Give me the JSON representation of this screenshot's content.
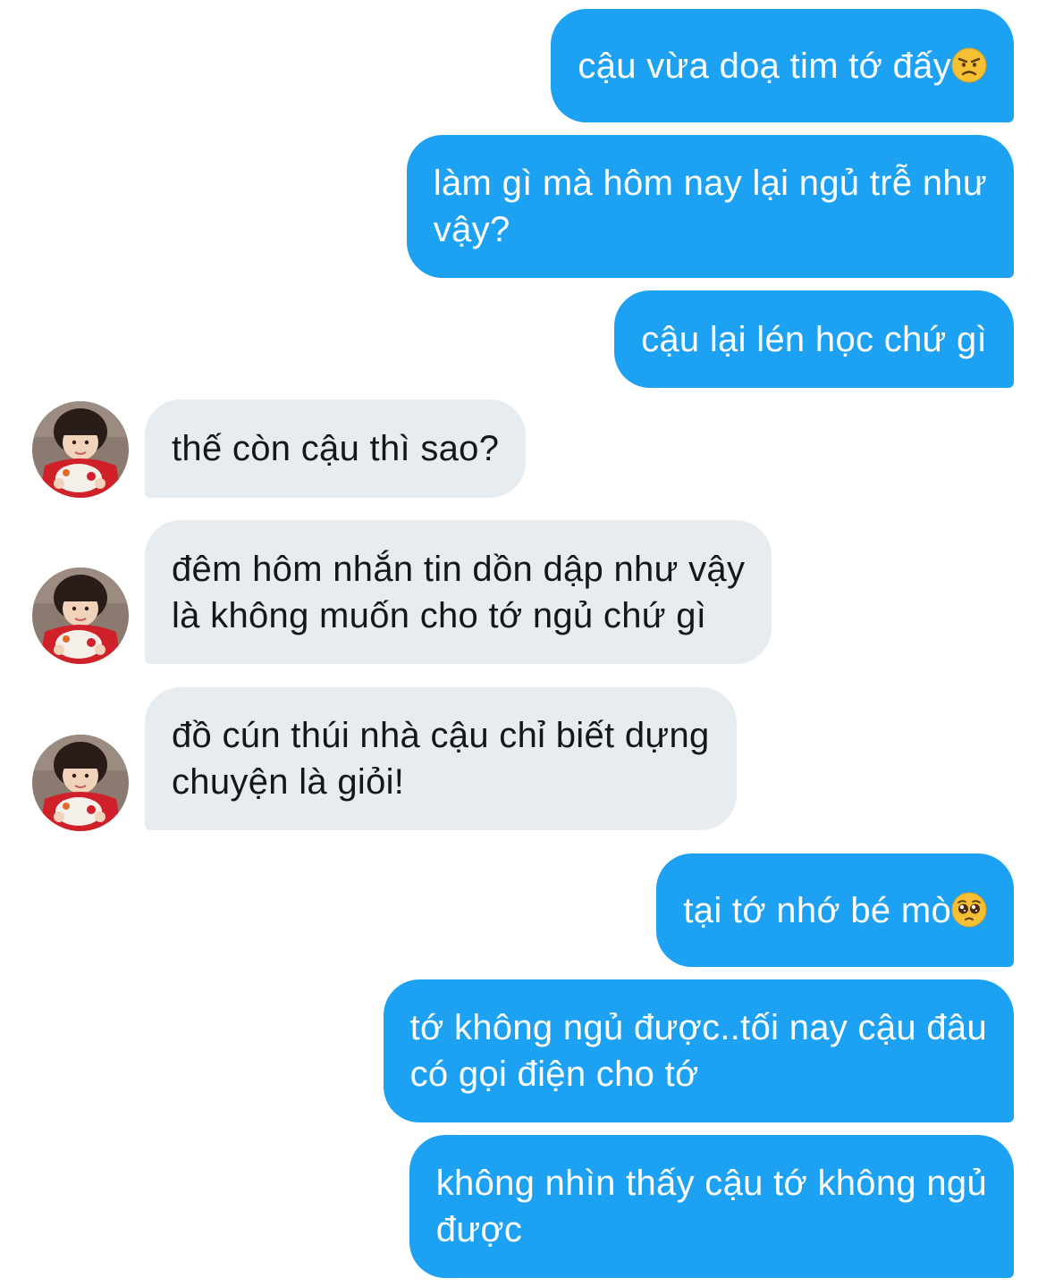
{
  "conversation": {
    "messages": [
      {
        "id": "m1",
        "from": "me",
        "text": "cậu vừa doạ tim tớ đấy",
        "emoji": "angry-face-emoji"
      },
      {
        "id": "m2",
        "from": "me",
        "lines": [
          "làm gì mà hôm nay lại ngủ trễ như",
          "vậy?"
        ]
      },
      {
        "id": "m3",
        "from": "me",
        "text": "cậu lại lén học chứ gì"
      },
      {
        "id": "m4",
        "from": "them",
        "text": "thế còn cậu thì sao?"
      },
      {
        "id": "m5",
        "from": "them",
        "lines": [
          "đêm hôm nhắn tin dồn dập như vậy",
          "là không muốn cho tớ ngủ chứ gì"
        ]
      },
      {
        "id": "m6",
        "from": "them",
        "lines": [
          "đồ cún thúi nhà cậu chỉ biết dựng",
          "chuyện là giỏi!"
        ]
      },
      {
        "id": "m7",
        "from": "me",
        "text": "tại tớ nhớ bé mò",
        "emoji": "pleading-face-emoji"
      },
      {
        "id": "m8",
        "from": "me",
        "lines": [
          "tớ không ngủ được..tối nay cậu đâu",
          "có gọi điện cho tớ"
        ]
      },
      {
        "id": "m9",
        "from": "me",
        "lines": [
          "không nhìn thấy cậu tớ không ngủ",
          "được"
        ]
      }
    ]
  },
  "colors": {
    "outgoing_bubble": "#1da1f2",
    "incoming_bubble": "#e6ecf0",
    "outgoing_text": "#ffffff",
    "incoming_text": "#14171a"
  },
  "icons": {
    "avatar": "contact-avatar-photo"
  }
}
